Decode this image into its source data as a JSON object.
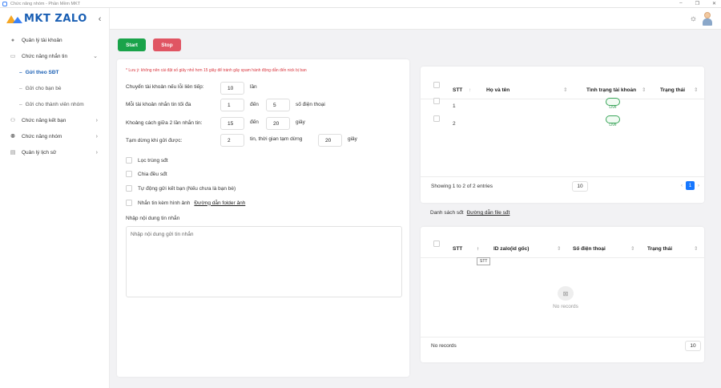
{
  "window": {
    "title": "Chức năng nhóm - Phần Mềm MKT",
    "controls": [
      "–",
      "❐",
      "✕"
    ]
  },
  "brand": {
    "name": "MKT ZALO"
  },
  "sidebar": {
    "items": [
      {
        "label": "Quản lý tài khoản",
        "icon": "user-group-icon"
      },
      {
        "label": "Chức năng nhắn tin",
        "icon": "message-icon",
        "expanded": true
      },
      {
        "label": "Chức năng kết bạn",
        "icon": "add-friend-icon"
      },
      {
        "label": "Chức năng nhóm",
        "icon": "group-icon"
      },
      {
        "label": "Quản lý lịch sử",
        "icon": "history-icon"
      }
    ],
    "subitems": [
      {
        "label": "Gửi theo SĐT",
        "active": true
      },
      {
        "label": "Gửi cho bạn bè"
      },
      {
        "label": "Gửi cho thành viên nhóm"
      }
    ]
  },
  "toolbar": {
    "start_label": "Start",
    "stop_label": "Stop"
  },
  "form": {
    "note": "* Lưu ý: không nên cài đặt số giây nhỏ hơn 15 giây để tránh gây spam hành động dẫn đến nick bị ban",
    "switch_account_label": "Chuyển tài khoản nếu lỗi liên tiếp:",
    "switch_account_value": "10",
    "switch_account_unit": "lần",
    "per_account_label": "Mỗi tài khoản nhắn tin tối đa",
    "per_account_from": "1",
    "to_label": "đến",
    "per_account_to": "5",
    "per_account_unit": "số điện thoại",
    "interval_label": "Khoảng cách giữa 2 lần nhắn tin:",
    "interval_from": "15",
    "interval_to": "20",
    "interval_unit": "giây",
    "pause_label": "Tạm dừng khi gửi được:",
    "pause_count": "2",
    "pause_mid": "tin, thời gian tạm dừng",
    "pause_time": "20",
    "pause_unit": "giây",
    "checkboxes": [
      "Lọc trùng sđt",
      "Chia đều sđt",
      "Tự động gửi kết bạn (Nếu chưa là bạn bè)",
      "Nhắn tin kèm hình ảnh"
    ],
    "image_folder_link": "Đường dẫn folder ảnh",
    "message_label": "Nhập nội dung tin nhắn",
    "message_placeholder": "Nhập nội dung gửi tin nhắn"
  },
  "accounts_table": {
    "columns": [
      "STT",
      "Họ và tên",
      "Tình trạng tài khoản",
      "Trạng thái"
    ],
    "rows": [
      {
        "stt": "1",
        "name": "",
        "status": "Live",
        "state": ""
      },
      {
        "stt": "2",
        "name": "",
        "status": "Live",
        "state": ""
      }
    ],
    "footer": "Showing 1 to 2 of 2 entries",
    "page_size": "10",
    "current_page": "1",
    "prev": "‹",
    "next": "›"
  },
  "phone_list": {
    "label": "Danh sách sđt",
    "file_link": "Đường dẫn file sđt",
    "columns": [
      "STT",
      "ID zalo(id gốc)",
      "Số điện thoại",
      "Trạng thái"
    ],
    "tooltip": "STT",
    "empty": "No records",
    "footer": "No records",
    "page_size": "10"
  },
  "colors": {
    "start": "#1aa34a",
    "stop": "#e05563",
    "brand": "#1a5fb4",
    "page_active": "#1677ff",
    "live": "#2f9a50"
  }
}
